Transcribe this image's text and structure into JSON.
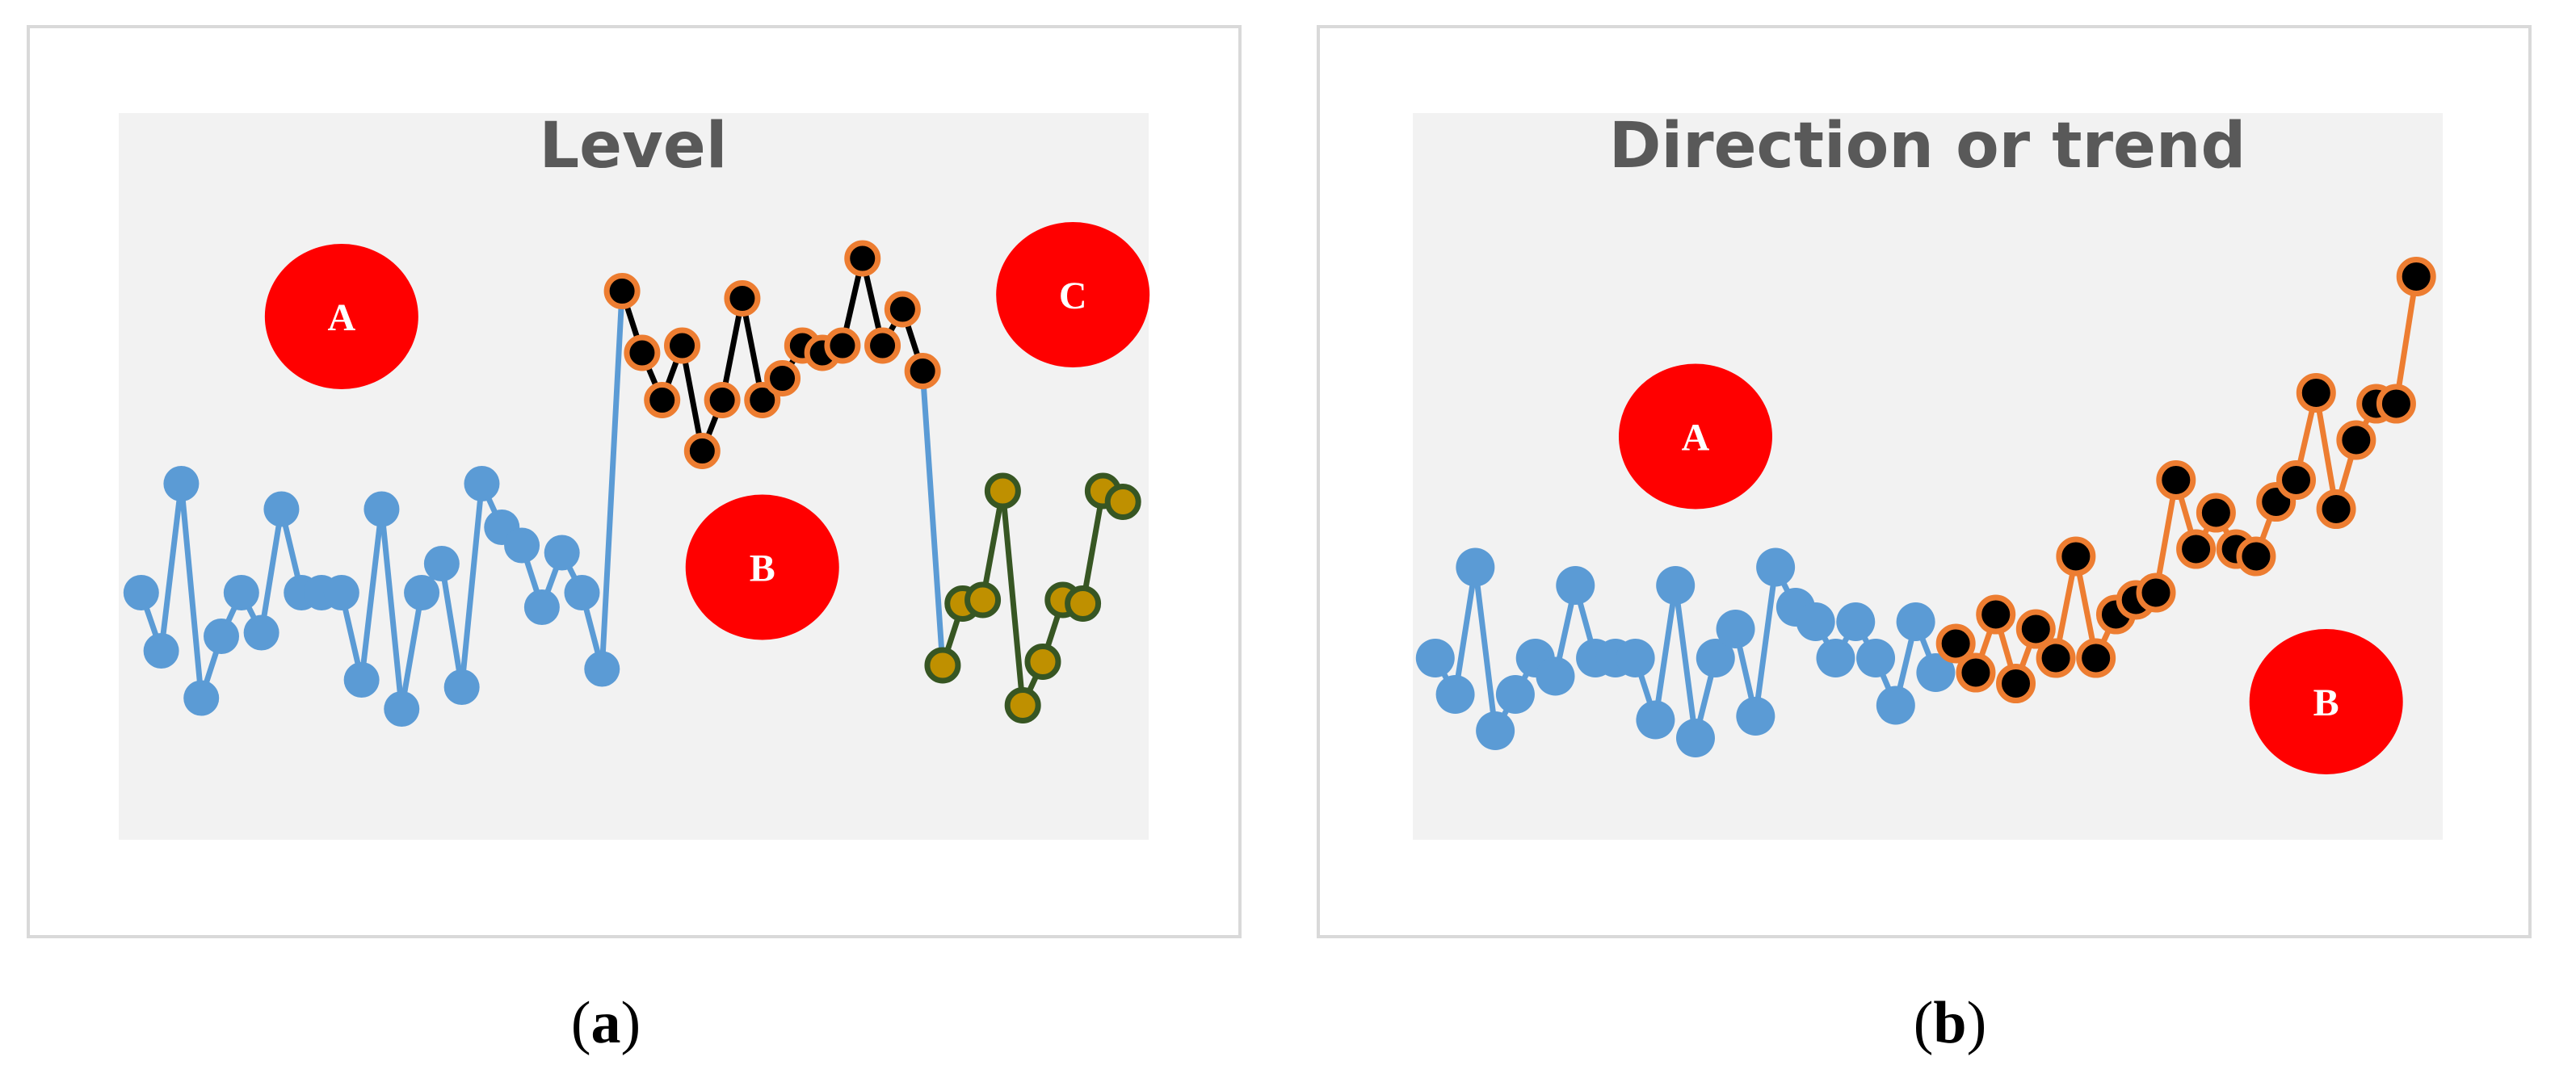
{
  "chart_data": [
    {
      "panel": "a",
      "caption_open": "(",
      "caption_letter": "a",
      "caption_close": ")",
      "type": "line",
      "title": "Level",
      "xlim": [
        0,
        51
      ],
      "ylim": [
        0,
        20
      ],
      "phase_labels": [
        {
          "label": "A",
          "x": 11,
          "y": 14.4
        },
        {
          "label": "B",
          "x": 32,
          "y": 7.5
        },
        {
          "label": "C",
          "x": 47.5,
          "y": 15
        }
      ],
      "series": [
        {
          "x": [
            1,
            2,
            3,
            4,
            5,
            6,
            7,
            8,
            9,
            10,
            11,
            12,
            13,
            14,
            15,
            16,
            17,
            18,
            19,
            20,
            21,
            22,
            23,
            24,
            25,
            26,
            27,
            28,
            29,
            30,
            31,
            32,
            33,
            34,
            35,
            36,
            37,
            38,
            39,
            40,
            41,
            42,
            43,
            44,
            45,
            46,
            47,
            48,
            49,
            50
          ],
          "y": [
            6.8,
            5.2,
            9.8,
            3.9,
            5.6,
            6.8,
            5.7,
            9.1,
            6.8,
            6.8,
            6.8,
            4.4,
            9.1,
            3.6,
            6.8,
            7.6,
            4.2,
            9.8,
            8.6,
            8.1,
            6.4,
            7.9,
            6.8,
            4.7,
            15.1,
            13.4,
            12.1,
            13.6,
            10.7,
            12.1,
            14.9,
            12.1,
            12.7,
            13.6,
            13.4,
            13.6,
            16.0,
            13.6,
            14.6,
            12.9,
            4.8,
            6.5,
            6.6,
            9.6,
            3.7,
            4.9,
            6.6,
            6.5,
            9.6,
            9.3
          ],
          "phase_of_point": [
            "A",
            "A",
            "A",
            "A",
            "A",
            "A",
            "A",
            "A",
            "A",
            "A",
            "A",
            "A",
            "A",
            "A",
            "A",
            "A",
            "A",
            "A",
            "A",
            "A",
            "A",
            "A",
            "A",
            "A",
            "B",
            "B",
            "B",
            "B",
            "B",
            "B",
            "B",
            "B",
            "B",
            "B",
            "B",
            "B",
            "B",
            "B",
            "B",
            "B",
            "C",
            "C",
            "C",
            "C",
            "C",
            "C",
            "C",
            "C",
            "C",
            "C"
          ]
        }
      ],
      "colors": {
        "A_line": "#5b9bd5",
        "A_marker": "#5b9bd5",
        "B_line": "#000000",
        "B_marker_fill": "#000000",
        "B_marker_edge": "#ed7d31",
        "C_line": "#375623",
        "C_marker_fill": "#bf9000",
        "C_marker_edge": "#375623",
        "phase_circle": "#ff0000",
        "plot_bg": "#f2f2f2"
      }
    },
    {
      "panel": "b",
      "caption_open": "(",
      "caption_letter": "b",
      "caption_close": ")",
      "type": "line",
      "title": "Direction or trend",
      "xlim": [
        0,
        51
      ],
      "ylim": [
        0,
        20
      ],
      "phase_labels": [
        {
          "label": "A",
          "x": 14,
          "y": 11.1
        },
        {
          "label": "B",
          "x": 45.5,
          "y": 3.8
        }
      ],
      "series": [
        {
          "x": [
            1,
            2,
            3,
            4,
            5,
            6,
            7,
            8,
            9,
            10,
            11,
            12,
            13,
            14,
            15,
            16,
            17,
            18,
            19,
            20,
            21,
            22,
            23,
            24,
            25,
            26,
            27,
            28,
            29,
            30,
            31,
            32,
            33,
            34,
            35,
            36,
            37,
            38,
            39,
            40,
            41,
            42,
            43,
            44,
            45,
            46,
            47,
            48,
            49,
            50
          ],
          "y": [
            5,
            4,
            7.5,
            3,
            4,
            5,
            4.5,
            7,
            5,
            5,
            5,
            3.3,
            7,
            2.8,
            5,
            5.8,
            3.4,
            7.5,
            6.4,
            6,
            5,
            6,
            5,
            3.7,
            6,
            4.6,
            5.4,
            4.6,
            6.2,
            4.3,
            5.8,
            5,
            7.8,
            5,
            6.2,
            6.6,
            6.8,
            9.9,
            8,
            9,
            8,
            7.8,
            9.3,
            9.9,
            12.3,
            9.1,
            11,
            12,
            12,
            15.5
          ],
          "phase_of_point": [
            "A",
            "A",
            "A",
            "A",
            "A",
            "A",
            "A",
            "A",
            "A",
            "A",
            "A",
            "A",
            "A",
            "A",
            "A",
            "A",
            "A",
            "A",
            "A",
            "A",
            "A",
            "A",
            "A",
            "A",
            "A",
            "A",
            "B",
            "B",
            "B",
            "B",
            "B",
            "B",
            "B",
            "B",
            "B",
            "B",
            "B",
            "B",
            "B",
            "B",
            "B",
            "B",
            "B",
            "B",
            "B",
            "B",
            "B",
            "B",
            "B",
            "B"
          ]
        }
      ],
      "colors": {
        "A_line": "#5b9bd5",
        "A_marker": "#5b9bd5",
        "B_line": "#ed7d31",
        "B_marker_fill": "#000000",
        "B_marker_edge": "#ed7d31",
        "phase_circle": "#ff0000",
        "plot_bg": "#f2f2f2"
      }
    }
  ]
}
